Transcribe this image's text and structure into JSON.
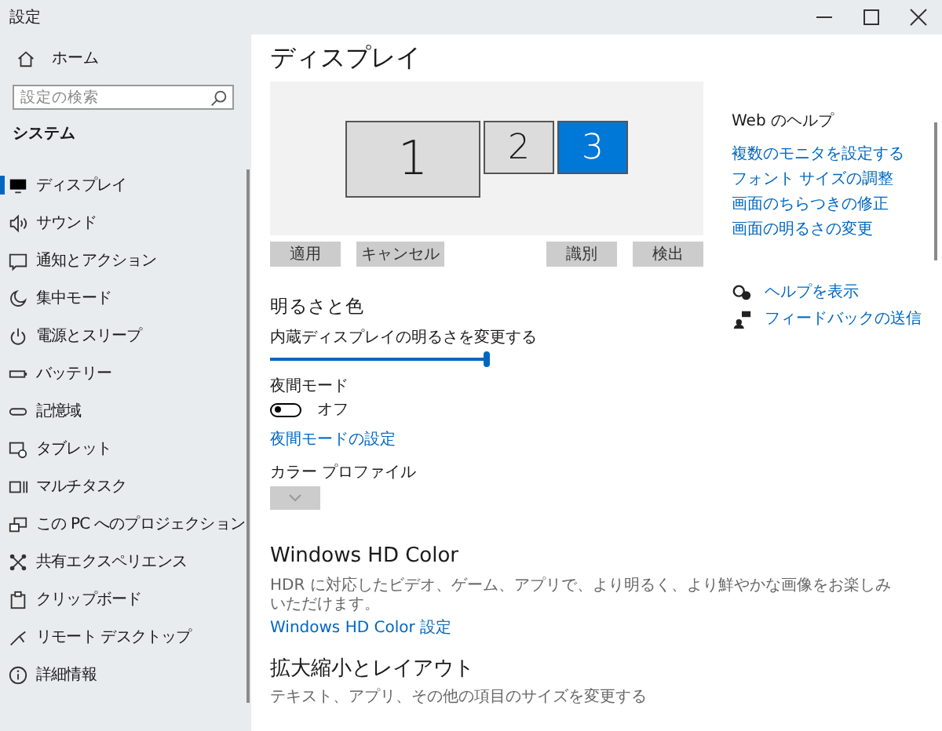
{
  "window": {
    "title": "設定"
  },
  "sidebar": {
    "home": "ホーム",
    "search": {
      "placeholder": "設定の検索"
    },
    "section": "システム",
    "items": [
      {
        "label": "ディスプレイ",
        "selected": true
      },
      {
        "label": "サウンド",
        "selected": false
      },
      {
        "label": "通知とアクション",
        "selected": false
      },
      {
        "label": "集中モード",
        "selected": false
      },
      {
        "label": "電源とスリープ",
        "selected": false
      },
      {
        "label": "バッテリー",
        "selected": false
      },
      {
        "label": "記憶域",
        "selected": false
      },
      {
        "label": "タブレット",
        "selected": false
      },
      {
        "label": "マルチタスク",
        "selected": false
      },
      {
        "label": "この PC へのプロジェクション",
        "selected": false
      },
      {
        "label": "共有エクスペリエンス",
        "selected": false
      },
      {
        "label": "クリップボード",
        "selected": false
      },
      {
        "label": "リモート デスクトップ",
        "selected": false
      },
      {
        "label": "詳細情報",
        "selected": false
      }
    ]
  },
  "page": {
    "title": "ディスプレイ",
    "monitors": [
      {
        "label": "1",
        "kind": "large",
        "selected": false
      },
      {
        "label": "2",
        "kind": "small",
        "selected": false
      },
      {
        "label": "3",
        "kind": "small",
        "selected": true
      }
    ],
    "left_buttons": [
      "適用",
      "キャンセル"
    ],
    "right_buttons": [
      "識別",
      "検出"
    ],
    "brightness": {
      "heading": "明るさと色",
      "label": "内蔵ディスプレイの明るさを変更する",
      "level": 1
    },
    "night_mode": {
      "label": "夜間モード",
      "on": false,
      "state_text": "オフ",
      "link": "夜間モードの設定"
    },
    "color_profile": {
      "label": "カラー プロファイル",
      "disabled": true
    },
    "hd_color": {
      "heading": "Windows HD Color",
      "description": "HDR に対応したビデオ、ゲーム、アプリで、より明るく、より鮮やかな画像をお楽しみいただけます。",
      "link": "Windows HD Color 設定"
    },
    "scale": {
      "heading": "拡大縮小とレイアウト",
      "description": "テキスト、アプリ、その他の項目のサイズを変更する"
    }
  },
  "help": {
    "heading": "Web のヘルプ",
    "links": [
      "複数のモニタを設定する",
      "フォント サイズの調整",
      "画面のちらつきの修正",
      "画面の明るさの変更"
    ],
    "actions": [
      {
        "label": "ヘルプを表示",
        "kind": "help"
      },
      {
        "label": "フィードバックの送信",
        "kind": "feedback"
      }
    ]
  }
}
